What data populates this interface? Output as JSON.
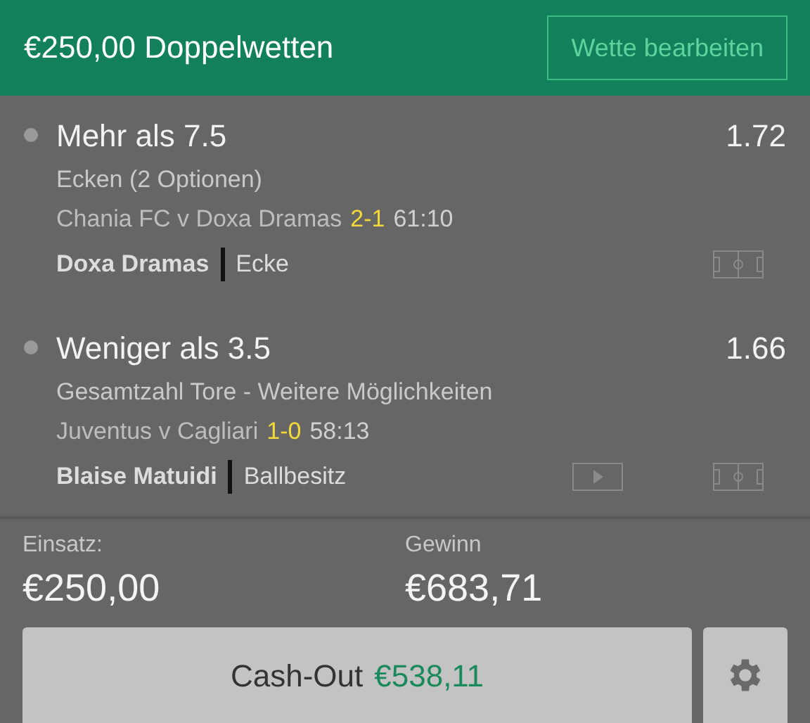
{
  "header": {
    "title": "€250,00 Doppelwetten",
    "edit_button": "Wette bearbeiten"
  },
  "legs": [
    {
      "selection": "Mehr als 7.5",
      "odds": "1.72",
      "market": "Ecken (2 Optionen)",
      "match": "Chania FC v Doxa Dramas",
      "score": "2-1",
      "time": "61:10",
      "player": "Doxa Dramas",
      "stat": "Ecke",
      "video": false
    },
    {
      "selection": "Weniger als 3.5",
      "odds": "1.66",
      "market": "Gesamtzahl Tore - Weitere Möglichkeiten",
      "match": "Juventus v Cagliari",
      "score": "1-0",
      "time": "58:13",
      "player": "Blaise Matuidi",
      "stat": "Ballbesitz",
      "video": true
    }
  ],
  "summary": {
    "stake_label": "Einsatz:",
    "stake": "€250,00",
    "return_label": "Gewinn",
    "return": "€683,71"
  },
  "cashout": {
    "label": "Cash-Out",
    "amount": "€538,11"
  }
}
